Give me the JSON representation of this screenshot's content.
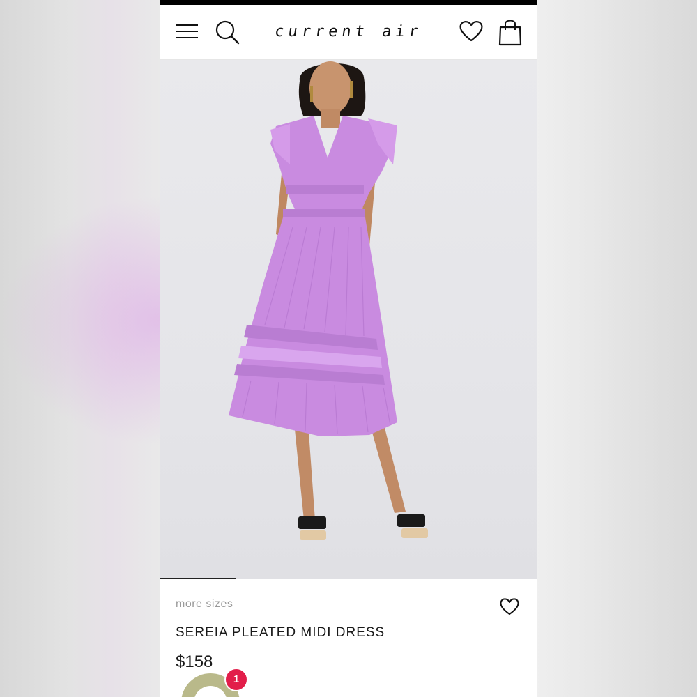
{
  "header": {
    "logo_text": "current air",
    "icons": [
      "menu-icon",
      "search-icon",
      "heart-icon",
      "shopping-bag-icon"
    ]
  },
  "product": {
    "more_sizes_label": "more sizes",
    "name": "SEREIA PLEATED MIDI DRESS",
    "price": "$158",
    "dress_color": "#c98be0"
  },
  "notifications": {
    "badge_count": "1"
  },
  "colors": {
    "accent_badge": "#e21e4a",
    "text": "#1a1a1a",
    "muted": "#9a9a9a"
  }
}
